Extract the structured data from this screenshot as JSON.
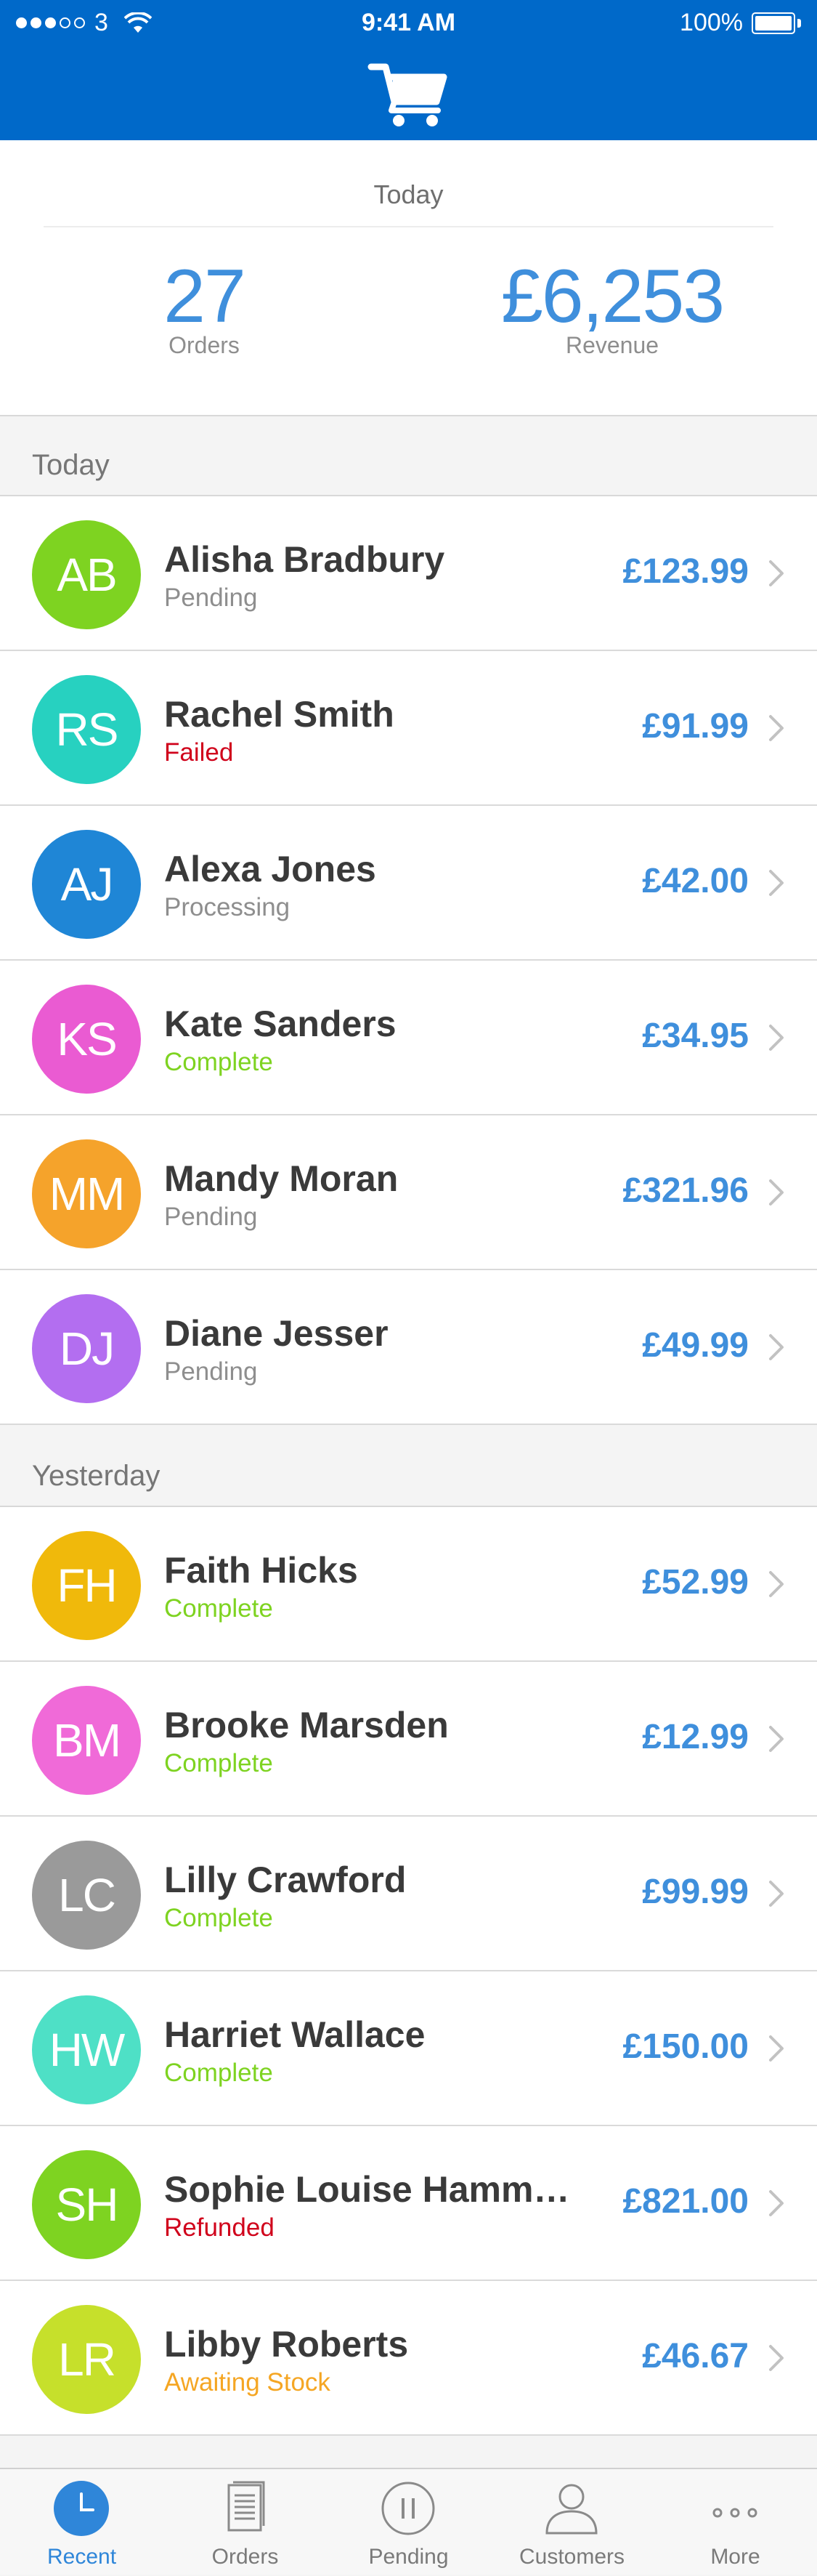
{
  "status_bar": {
    "carrier": "3",
    "time": "9:41 AM",
    "battery": "100%"
  },
  "header": {
    "icon": "shopping-cart-icon"
  },
  "summary": {
    "period": "Today",
    "orders_value": "27",
    "orders_label": "Orders",
    "revenue_value": "£6,253",
    "revenue_label": "Revenue"
  },
  "colors": {
    "brand_blue": "#0069c9",
    "price_blue": "#3f8fdc",
    "pending": "#8e8e8e",
    "failed": "#d0021b",
    "processing": "#8e8e8e",
    "complete": "#7ed321",
    "refunded": "#d0021b",
    "awaiting_stock": "#f5a623"
  },
  "sections": [
    {
      "title": "Today",
      "orders": [
        {
          "initials": "AB",
          "name": "Alisha Bradbury",
          "status": "Pending",
          "status_color": "#8e8e8e",
          "price": "£123.99",
          "avatar_color": "#7ed321"
        },
        {
          "initials": "RS",
          "name": "Rachel Smith",
          "status": "Failed",
          "status_color": "#d0021b",
          "price": "£91.99",
          "avatar_color": "#27d1c0"
        },
        {
          "initials": "AJ",
          "name": "Alexa Jones",
          "status": "Processing",
          "status_color": "#8e8e8e",
          "price": "£42.00",
          "avatar_color": "#1f86d6"
        },
        {
          "initials": "KS",
          "name": "Kate Sanders",
          "status": "Complete",
          "status_color": "#7ed321",
          "price": "£34.95",
          "avatar_color": "#ea5bd2"
        },
        {
          "initials": "MM",
          "name": "Mandy Moran",
          "status": "Pending",
          "status_color": "#8e8e8e",
          "price": "£321.96",
          "avatar_color": "#f5a32b"
        },
        {
          "initials": "DJ",
          "name": "Diane Jesser",
          "status": "Pending",
          "status_color": "#8e8e8e",
          "price": "£49.99",
          "avatar_color": "#b36ef0"
        }
      ]
    },
    {
      "title": "Yesterday",
      "orders": [
        {
          "initials": "FH",
          "name": "Faith Hicks",
          "status": "Complete",
          "status_color": "#7ed321",
          "price": "£52.99",
          "avatar_color": "#f0b90b"
        },
        {
          "initials": "BM",
          "name": "Brooke Marsden",
          "status": "Complete",
          "status_color": "#7ed321",
          "price": "£12.99",
          "avatar_color": "#f06ad8"
        },
        {
          "initials": "LC",
          "name": "Lilly Crawford",
          "status": "Complete",
          "status_color": "#7ed321",
          "price": "£99.99",
          "avatar_color": "#9a9a9a"
        },
        {
          "initials": "HW",
          "name": "Harriet Wallace",
          "status": "Complete",
          "status_color": "#7ed321",
          "price": "£150.00",
          "avatar_color": "#4ee0c6"
        },
        {
          "initials": "SH",
          "name": "Sophie Louise Hamm…",
          "status": "Refunded",
          "status_color": "#d0021b",
          "price": "£821.00",
          "avatar_color": "#7ed321"
        },
        {
          "initials": "LR",
          "name": "Libby Roberts",
          "status": "Awaiting Stock",
          "status_color": "#f5a623",
          "price": "£46.67",
          "avatar_color": "#c6e02b"
        }
      ]
    }
  ],
  "tabbar": {
    "tabs": [
      {
        "label": "Recent",
        "icon": "clock-icon",
        "active": true
      },
      {
        "label": "Orders",
        "icon": "orders-list-icon",
        "active": false
      },
      {
        "label": "Pending",
        "icon": "pause-icon",
        "active": false
      },
      {
        "label": "Customers",
        "icon": "person-icon",
        "active": false
      },
      {
        "label": "More",
        "icon": "more-dots-icon",
        "active": false
      }
    ]
  }
}
